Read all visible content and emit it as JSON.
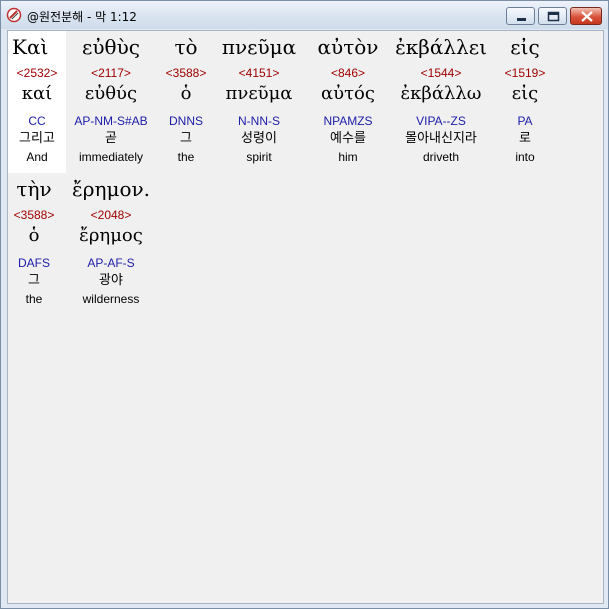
{
  "window": {
    "title": "@원전분해 - 막 1:12",
    "icon": "app-icon"
  },
  "words": [
    {
      "greek": "Καὶ",
      "strong": "<2532>",
      "lemma": "καί",
      "parse": "CC",
      "korean": "그리고",
      "english": "And"
    },
    {
      "greek": "εὐθὺς",
      "strong": "<2117>",
      "lemma": "εὐθύς",
      "parse": "AP-NM-S#AB",
      "korean": "곧",
      "english": "immediately"
    },
    {
      "greek": "τὸ",
      "strong": "<3588>",
      "lemma": "ὁ",
      "parse": "DNNS",
      "korean": "그",
      "english": "the"
    },
    {
      "greek": "πνεῦμα",
      "strong": "<4151>",
      "lemma": "πνεῦμα",
      "parse": "N-NN-S",
      "korean": "성령이",
      "english": "spirit"
    },
    {
      "greek": "αὐτὸν",
      "strong": "<846>",
      "lemma": "αὐτός",
      "parse": "NPAMZS",
      "korean": "예수를",
      "english": "him"
    },
    {
      "greek": "ἐκβάλλει",
      "strong": "<1544>",
      "lemma": "ἐκβάλλω",
      "parse": "VIPA--ZS",
      "korean": "몰아내신지라",
      "english": "driveth"
    },
    {
      "greek": "εἰς",
      "strong": "<1519>",
      "lemma": "εἰς",
      "parse": "PA",
      "korean": "로",
      "english": "into"
    },
    {
      "greek": "τὴν",
      "strong": "<3588>",
      "lemma": "ὁ",
      "parse": "DAFS",
      "korean": "그",
      "english": "the"
    },
    {
      "greek": "ἔρημον.",
      "strong": "<2048>",
      "lemma": "ἔρημος",
      "parse": "AP-AF-S",
      "korean": "광야",
      "english": "wilderness"
    }
  ]
}
